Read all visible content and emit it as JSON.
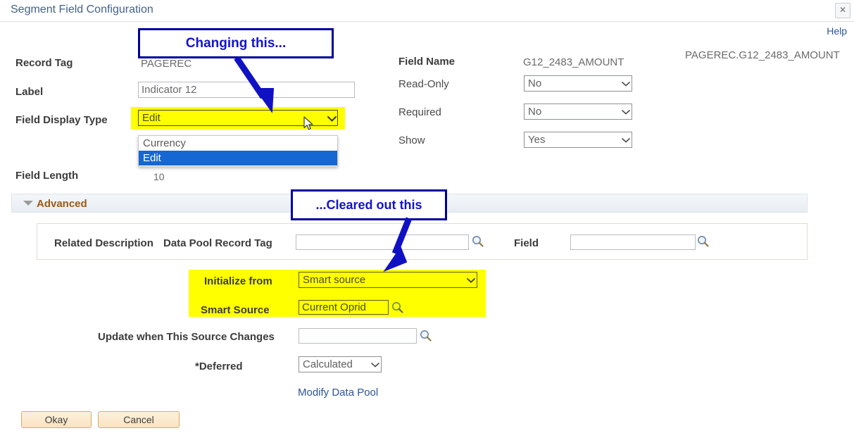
{
  "window": {
    "title": "Segment Field Configuration",
    "close_icon": "close-icon",
    "help_label": "Help"
  },
  "left_form": {
    "record_tag": {
      "label": "Record Tag",
      "value": "PAGEREC"
    },
    "label_field": {
      "label": "Label",
      "value": "Indicator 12"
    },
    "field_display_type": {
      "label": "Field Display Type",
      "value": "Edit",
      "options": [
        "Currency",
        "Edit"
      ],
      "selected_option": "Edit",
      "expanded": true,
      "highlight_color": "#ffff00"
    },
    "field_length": {
      "label": "Field Length",
      "value": "10"
    }
  },
  "right_form": {
    "field_name": {
      "label": "Field Name",
      "value": "G12_2483_AMOUNT"
    },
    "read_only": {
      "label": "Read-Only",
      "value": "No"
    },
    "required": {
      "label": "Required",
      "value": "No"
    },
    "show": {
      "label": "Show",
      "value": "Yes"
    },
    "qualified_name": "PAGEREC.G12_2483_AMOUNT"
  },
  "advanced": {
    "section_label": "Advanced",
    "expanded": true,
    "related_description_label": "Related Description",
    "data_pool_record_tag_label": "Data Pool Record Tag",
    "data_pool_record_tag_value": "",
    "field_label": "Field",
    "field_value": "",
    "initialize_from": {
      "label": "Initialize from",
      "value": "Smart source"
    },
    "smart_source": {
      "label": "Smart Source",
      "value": "Current Oprid"
    },
    "update_when_source_changes": {
      "label": "Update when This Source Changes",
      "value": ""
    },
    "deferred": {
      "label": "*Deferred",
      "value": "Calculated"
    },
    "modify_data_pool_link": "Modify Data Pool"
  },
  "footer": {
    "okay_label": "Okay",
    "cancel_label": "Cancel"
  },
  "annotations": {
    "callout_1": "Changing this...",
    "callout_2": "...Cleared out this",
    "callout_color": "#00009c"
  }
}
